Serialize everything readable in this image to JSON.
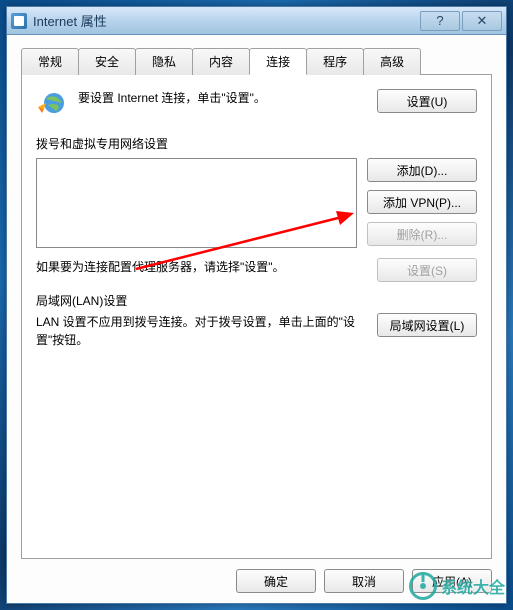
{
  "titlebar": {
    "title": "Internet 属性",
    "help_glyph": "?",
    "close_glyph": "✕"
  },
  "tabs": {
    "general": "常规",
    "security": "安全",
    "privacy": "隐私",
    "content": "内容",
    "connections": "连接",
    "programs": "程序",
    "advanced": "高级"
  },
  "setup": {
    "text": "要设置 Internet 连接，单击\"设置\"。",
    "button": "设置(U)"
  },
  "dialup": {
    "title": "拨号和虚拟专用网络设置",
    "add_button": "添加(D)...",
    "add_vpn_button": "添加 VPN(P)...",
    "remove_button": "删除(R)...",
    "proxy_text": "如果要为连接配置代理服务器，请选择\"设置\"。",
    "settings_button": "设置(S)"
  },
  "lan": {
    "title": "局域网(LAN)设置",
    "text": "LAN 设置不应用到拨号连接。对于拨号设置，单击上面的\"设置\"按钮。",
    "button": "局域网设置(L)"
  },
  "dialog": {
    "ok": "确定",
    "cancel": "取消",
    "apply": "应用(A)"
  },
  "watermark": {
    "text": "系统大全"
  }
}
